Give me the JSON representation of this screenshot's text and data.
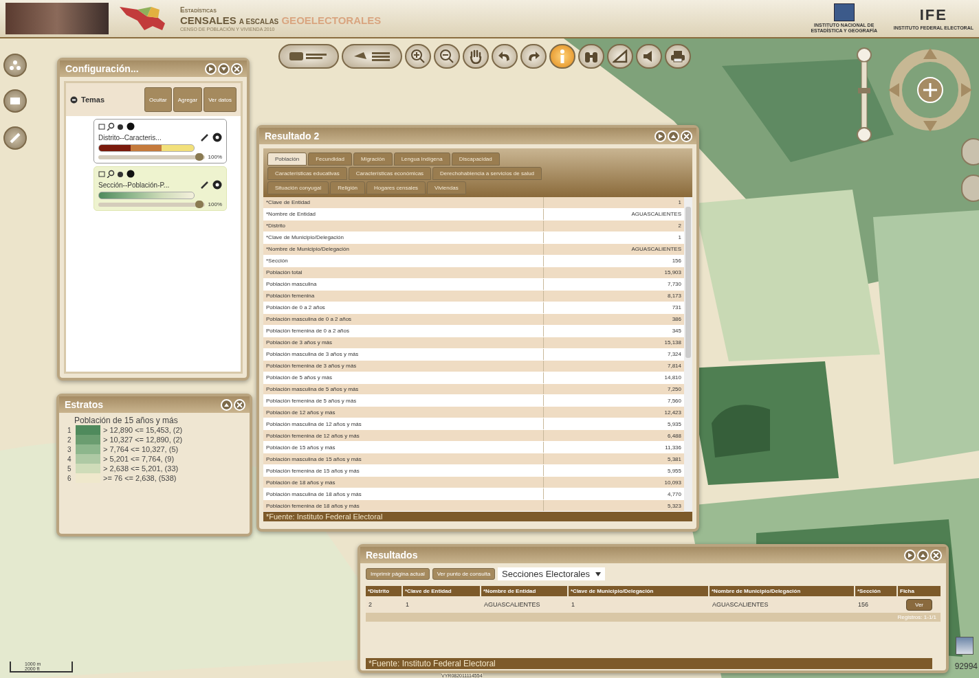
{
  "header": {
    "kicker": "Estadísticas",
    "title_main": "CENSALES",
    "title_mid": "A ESCALAS",
    "title_accent": "GEOELECTORALES",
    "subtitle": "CENSO DE POBLACIÓN Y VIVIENDA 2010",
    "inegi_caption": "INSTITUTO NACIONAL DE ESTADÍSTICA Y GEOGRAFÍA",
    "ife_logo": "IFE",
    "ife_caption": "INSTITUTO FEDERAL ELECTORAL"
  },
  "toolbar": [
    {
      "kind": "wide-globe",
      "selected": false
    },
    {
      "kind": "wide-layers",
      "selected": false
    },
    {
      "kind": "zoom-in",
      "selected": false
    },
    {
      "kind": "zoom-out",
      "selected": false
    },
    {
      "kind": "hand",
      "selected": false
    },
    {
      "kind": "back",
      "selected": false
    },
    {
      "kind": "forward",
      "selected": false
    },
    {
      "kind": "info",
      "selected": true
    },
    {
      "kind": "binoculars",
      "selected": false
    },
    {
      "kind": "ruler",
      "selected": false
    },
    {
      "kind": "speaker",
      "selected": false
    },
    {
      "kind": "printer",
      "selected": false
    }
  ],
  "config": {
    "title": "Configuración...",
    "section": "Temas",
    "buttons": [
      "Ocultar",
      "Agregar",
      "Ver datos"
    ],
    "layers": [
      {
        "name": "Distrito--Caracteris...",
        "opacity": "100%",
        "level": 0.95,
        "selected": false,
        "kind": "warm"
      },
      {
        "name": "Sección--Población-P...",
        "opacity": "100%",
        "level": 0.95,
        "selected": true,
        "kind": "green"
      }
    ]
  },
  "strata": {
    "title": "Estratos",
    "heading": "Población de 15 años y más",
    "items": [
      {
        "number": "1",
        "label": "> 12,890 <= 15,453, (2)",
        "color": "#4f8a5c"
      },
      {
        "number": "2",
        "label": "> 10,327 <= 12,890, (2)",
        "color": "#6b9d70"
      },
      {
        "number": "3",
        "label": "> 7,764 <= 10,327, (5)",
        "color": "#8db68c"
      },
      {
        "number": "4",
        "label": "> 5,201 <= 7,764, (9)",
        "color": "#aec9a4"
      },
      {
        "number": "5",
        "label": "> 2,638 <= 5,201, (33)",
        "color": "#cfdcb9"
      },
      {
        "number": "6",
        "label": ">= 76 <= 2,638, (538)",
        "color": "#efe8cc"
      }
    ]
  },
  "result2": {
    "title": "Resultado 2",
    "tab_rows": [
      [
        {
          "label": "Población",
          "selected": true
        },
        {
          "label": "Fecundidad",
          "selected": false
        },
        {
          "label": "Migración",
          "selected": false
        },
        {
          "label": "Lengua Indígena",
          "selected": false
        },
        {
          "label": "Discapacidad",
          "selected": false
        }
      ],
      [
        {
          "label": "Características educativas",
          "selected": false
        },
        {
          "label": "Características económicas",
          "selected": false
        },
        {
          "label": "Derechohabiencia a servicios de salud",
          "selected": false
        }
      ],
      [
        {
          "label": "Situación conyugal",
          "selected": false
        },
        {
          "label": "Religión",
          "selected": false
        },
        {
          "label": "Hogares censales",
          "selected": false
        },
        {
          "label": "Viviendas",
          "selected": false
        }
      ]
    ],
    "rows": [
      {
        "field": "*Clave de Entidad",
        "value": "1"
      },
      {
        "field": "*Nombre de Entidad",
        "value": "AGUASCALIENTES"
      },
      {
        "field": "*Distrito",
        "value": "2"
      },
      {
        "field": "*Clave de Municipio/Delegación",
        "value": "1"
      },
      {
        "field": "*Nombre de Municipio/Delegación",
        "value": "AGUASCALIENTES"
      },
      {
        "field": "*Sección",
        "value": "156"
      },
      {
        "field": "Población total",
        "value": "15,903"
      },
      {
        "field": "Población masculina",
        "value": "7,730"
      },
      {
        "field": "Población femenina",
        "value": "8,173"
      },
      {
        "field": "Población de 0 a 2 años",
        "value": "731"
      },
      {
        "field": "Población masculina de 0 a 2 años",
        "value": "386"
      },
      {
        "field": "Población femenina de 0 a 2 años",
        "value": "345"
      },
      {
        "field": "Población de 3 años y más",
        "value": "15,138"
      },
      {
        "field": "Población masculina de 3 años y más",
        "value": "7,324"
      },
      {
        "field": "Población femenina de 3 años y más",
        "value": "7,814"
      },
      {
        "field": "Población de 5 años y más",
        "value": "14,810"
      },
      {
        "field": "Población masculina de 5 años y más",
        "value": "7,250"
      },
      {
        "field": "Población femenina de 5 años y más",
        "value": "7,560"
      },
      {
        "field": "Población de 12 años y más",
        "value": "12,423"
      },
      {
        "field": "Población masculina de 12 años y más",
        "value": "5,935"
      },
      {
        "field": "Población femenina de 12 años y más",
        "value": "6,488"
      },
      {
        "field": "Población de 15 años y más",
        "value": "11,336"
      },
      {
        "field": "Población masculina de 15 años y más",
        "value": "5,381"
      },
      {
        "field": "Población femenina de 15 años y más",
        "value": "5,955"
      },
      {
        "field": "Población de 18 años y más",
        "value": "10,093"
      },
      {
        "field": "Población masculina de 18 años y más",
        "value": "4,770"
      },
      {
        "field": "Población femenina de 18 años y más",
        "value": "5,323"
      }
    ],
    "source": "*Fuente: Instituto Federal Electoral"
  },
  "results": {
    "title": "Resultados",
    "buttons": [
      "Imprimir página actual",
      "Ver punto de consulta"
    ],
    "layer_select": "Secciones Electorales",
    "columns": [
      "*Distrito",
      "*Clave de Entidad",
      "*Nombre de Entidad",
      "*Clave de Municipio/Delegación",
      "*Nombre de Municipio/Delegación",
      "*Sección",
      "Ficha"
    ],
    "rows": [
      {
        "cells": [
          "2",
          "1",
          "AGUASCALIENTES",
          "1",
          "AGUASCALIENTES",
          "156"
        ],
        "action": "Ver"
      }
    ],
    "records": "Registros: 1-1/1",
    "source": "*Fuente: Instituto Federal Electoral"
  },
  "map": {
    "scale_metric": "1000 m",
    "scale_imperial": "2000 ft",
    "corner_code": "92994",
    "footer_code": "VYR082011114554"
  }
}
